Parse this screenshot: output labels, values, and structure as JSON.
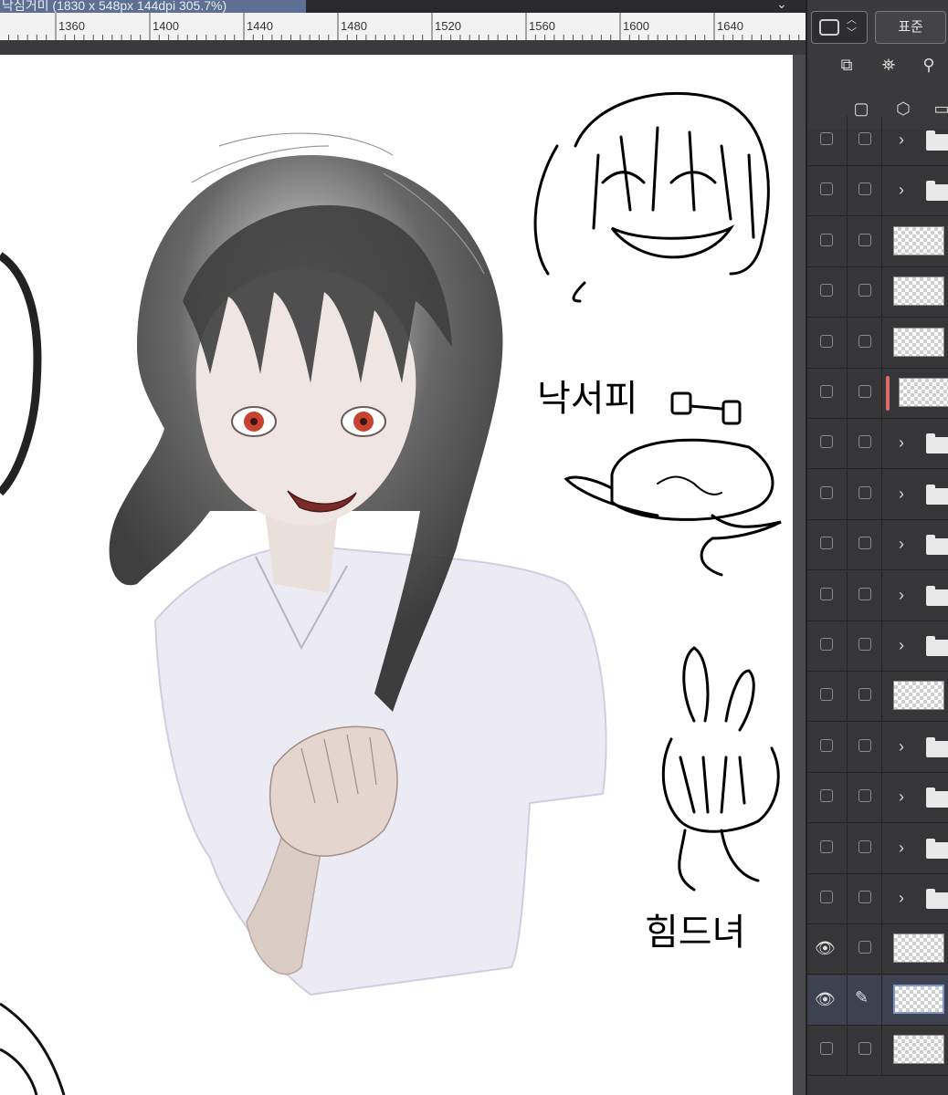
{
  "document_tab": {
    "title": "낙심거미 (1830 x 548px 144dpi 305.7%)"
  },
  "ruler": {
    "labels": [
      "1360",
      "1400",
      "1440",
      "1480",
      "1520",
      "1560",
      "1600",
      "1640"
    ]
  },
  "canvas": {
    "handwriting_1": "낙서피",
    "handwriting_2": "힘드녀"
  },
  "layer_panel": {
    "blend_mode_label": "표준",
    "layers": [
      {
        "type": "folder",
        "visible": false,
        "clipped": false,
        "selected": false
      },
      {
        "type": "folder",
        "visible": false,
        "clipped": false,
        "selected": false
      },
      {
        "type": "raster",
        "visible": false,
        "clipped": false,
        "selected": false
      },
      {
        "type": "raster",
        "visible": false,
        "clipped": false,
        "selected": false
      },
      {
        "type": "raster",
        "visible": false,
        "clipped": false,
        "selected": false
      },
      {
        "type": "raster",
        "visible": false,
        "clipped": true,
        "selected": false
      },
      {
        "type": "folder",
        "visible": false,
        "clipped": false,
        "selected": false
      },
      {
        "type": "folder",
        "visible": false,
        "clipped": false,
        "selected": false
      },
      {
        "type": "folder",
        "visible": false,
        "clipped": false,
        "selected": false
      },
      {
        "type": "folder",
        "visible": false,
        "clipped": false,
        "selected": false
      },
      {
        "type": "folder",
        "visible": false,
        "clipped": false,
        "selected": false
      },
      {
        "type": "raster",
        "visible": false,
        "clipped": false,
        "selected": false
      },
      {
        "type": "folder",
        "visible": false,
        "clipped": false,
        "selected": false
      },
      {
        "type": "folder",
        "visible": false,
        "clipped": false,
        "selected": false
      },
      {
        "type": "folder",
        "visible": false,
        "clipped": false,
        "selected": false
      },
      {
        "type": "folder",
        "visible": false,
        "clipped": false,
        "selected": false
      },
      {
        "type": "raster",
        "visible": true,
        "clipped": false,
        "selected": false
      },
      {
        "type": "raster",
        "visible": true,
        "clipped": false,
        "selected": true,
        "editing": true
      },
      {
        "type": "raster",
        "visible": false,
        "clipped": false,
        "selected": false
      }
    ]
  },
  "icons": {
    "tab_chevron": "chevron-down-icon",
    "ref_layer": "reference-layer-icon",
    "lighthouse": "lighthouse-icon",
    "mask": "mask-icon",
    "new_raster": "new-raster-layer-icon",
    "new_vector": "new-vector-layer-icon",
    "new_folder": "new-folder-icon"
  }
}
